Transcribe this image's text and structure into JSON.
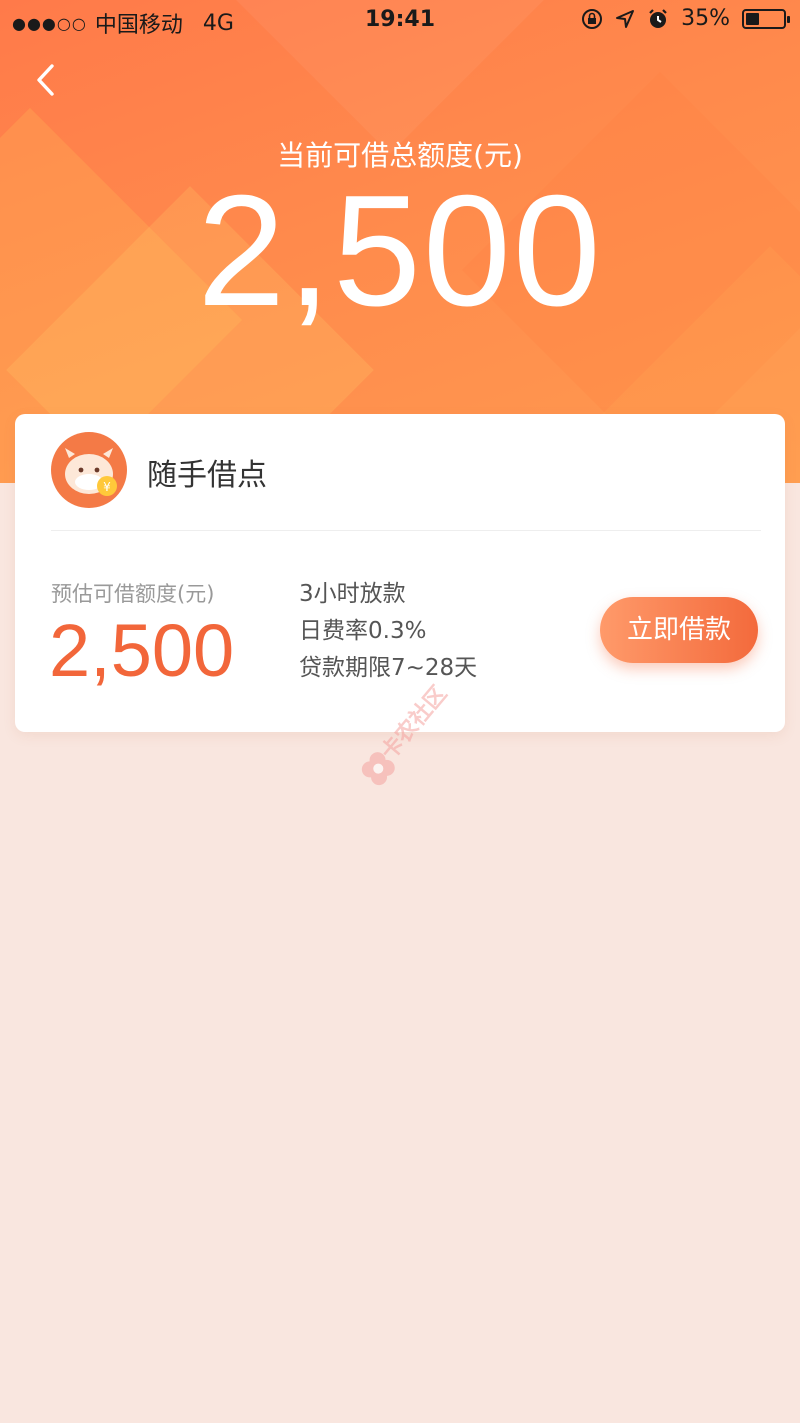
{
  "status_bar": {
    "signal_dots": "●●●○○",
    "carrier": "中国移动",
    "network": "4G",
    "time": "19:41",
    "battery_percent": "35%",
    "battery_level": 0.35
  },
  "header": {
    "total_credit_label": "当前可借总额度(元)",
    "total_credit_amount": "2,500"
  },
  "product_card": {
    "name": "随手借点",
    "estimated_label": "预估可借额度(元)",
    "estimated_amount": "2,500",
    "features": [
      "3小时放款",
      "日费率0.3%",
      "贷款期限7~28天"
    ],
    "apply_button": "立即借款"
  },
  "watermark": {
    "text": "卡农社区"
  },
  "colors": {
    "accent": "#f2663a",
    "hero_top": "#ff7a4a",
    "page_bg": "#f9e6df"
  }
}
